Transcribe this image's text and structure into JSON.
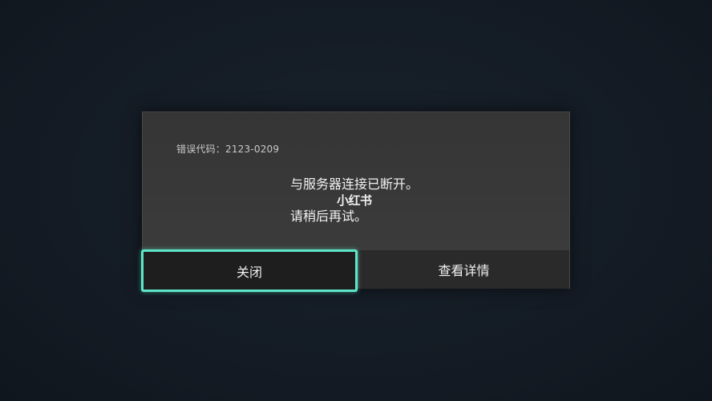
{
  "dialog": {
    "error_code": "错误代码：2123-0209",
    "message_line1": "与服务器连接已断开。",
    "message_line2": "请稍后再试。",
    "watermark": "小红书"
  },
  "buttons": {
    "close_label": "关闭",
    "details_label": "查看详情"
  },
  "colors": {
    "background": "#141c25",
    "dialog": "#3a3a3a",
    "focus_outline": "#5ce6c7"
  }
}
